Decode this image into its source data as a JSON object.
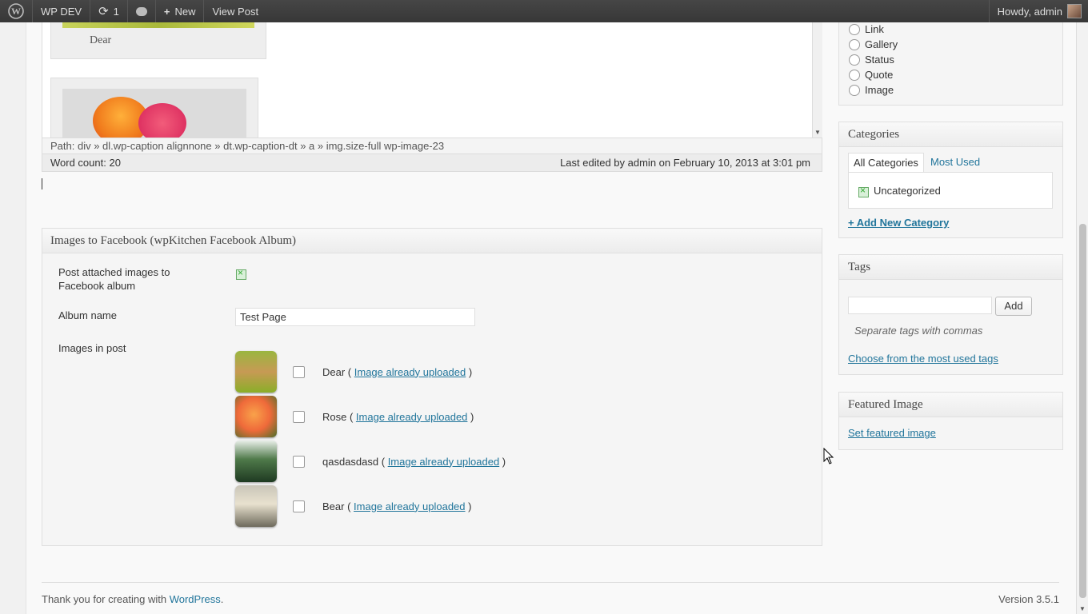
{
  "adminbar": {
    "site_name": "WP DEV",
    "updates_count": "1",
    "new_label": "New",
    "view_post_label": "View Post",
    "howdy": "Howdy, admin"
  },
  "editor": {
    "captions": [
      "Dear"
    ],
    "path": "Path: div » dl.wp-caption alignnone » dt.wp-caption-dt » a » img.size-full wp-image-23",
    "word_count": "Word count: 20",
    "last_edited": "Last edited by admin on February 10, 2013 at 3:01 pm"
  },
  "fb_box": {
    "title": "Images to Facebook (wpKitchen Facebook Album)",
    "post_attached_label": "Post attached images to Facebook album",
    "album_name_label": "Album name",
    "album_name_value": "Test Page",
    "images_label": "Images in post",
    "images": [
      {
        "name": "Dear",
        "link": "Image already uploaded"
      },
      {
        "name": "Rose",
        "link": "Image already uploaded"
      },
      {
        "name": "qasdasdasd",
        "link": "Image already uploaded"
      },
      {
        "name": "Bear",
        "link": "Image already uploaded"
      }
    ]
  },
  "format_box": {
    "options": [
      "Link",
      "Gallery",
      "Status",
      "Quote",
      "Image"
    ]
  },
  "categories_box": {
    "title": "Categories",
    "tab_all": "All Categories",
    "tab_most_used": "Most Used",
    "category": "Uncategorized",
    "add_new": "+ Add New Category"
  },
  "tags_box": {
    "title": "Tags",
    "add_button": "Add",
    "hint": "Separate tags with commas",
    "choose_link": "Choose from the most used tags"
  },
  "featured_box": {
    "title": "Featured Image",
    "set_link": "Set featured image"
  },
  "footer": {
    "thanks_prefix": "Thank you for creating with ",
    "wordpress_link": "WordPress",
    "thanks_suffix": ".",
    "version": "Version 3.5.1"
  },
  "colors": {
    "link": "#21759b",
    "adminbar": "#464646"
  }
}
